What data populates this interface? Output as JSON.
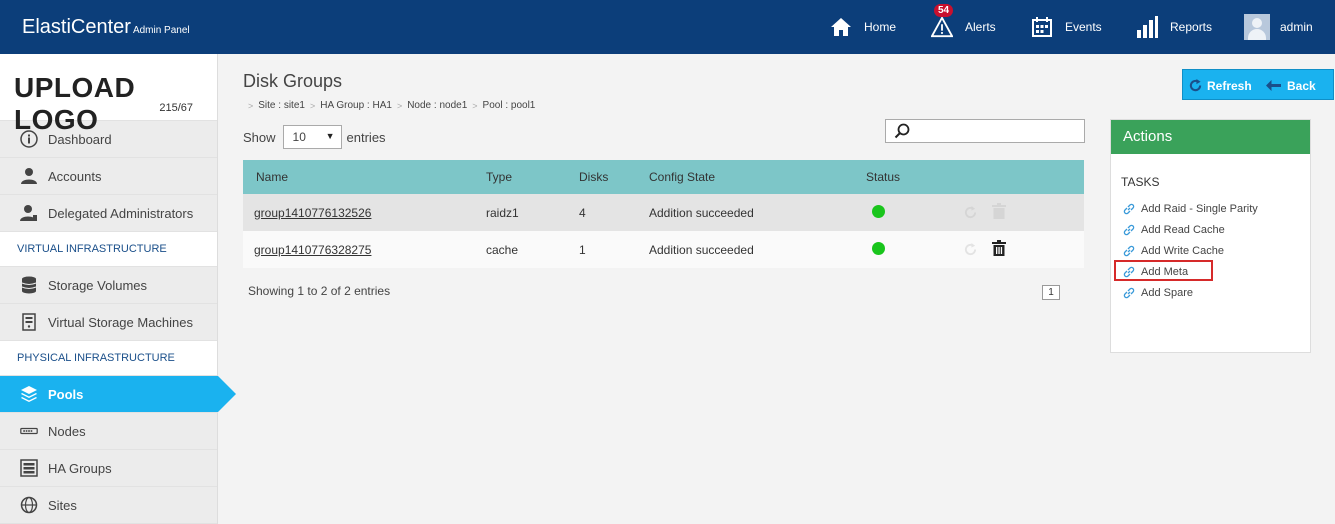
{
  "header": {
    "brand": "ElastiCenter",
    "brand_sub": "Admin Panel",
    "nav": {
      "home": "Home",
      "alerts": "Alerts",
      "alerts_badge": "54",
      "events": "Events",
      "reports": "Reports",
      "user": "admin"
    }
  },
  "sidebar": {
    "logo": "UPLOAD LOGO",
    "logo_dim": "215/67",
    "items_top": [
      {
        "label": "Dashboard",
        "icon": "info-icon"
      },
      {
        "label": "Accounts",
        "icon": "user-icon"
      },
      {
        "label": "Delegated Administrators",
        "icon": "admin-user-icon"
      }
    ],
    "section_virtual": "VIRTUAL INFRASTRUCTURE",
    "items_virtual": [
      {
        "label": "Storage Volumes",
        "icon": "database-icon"
      },
      {
        "label": "Virtual Storage Machines",
        "icon": "server-icon"
      }
    ],
    "section_physical": "PHYSICAL INFRASTRUCTURE",
    "items_physical": [
      {
        "label": "Pools",
        "icon": "layers-icon"
      },
      {
        "label": "Nodes",
        "icon": "node-icon"
      },
      {
        "label": "HA Groups",
        "icon": "rack-icon"
      },
      {
        "label": "Sites",
        "icon": "globe-icon"
      }
    ]
  },
  "main": {
    "title": "Disk Groups",
    "breadcrumb": [
      "Site : site1",
      "HA Group : HA1",
      "Node : node1",
      "Pool : pool1"
    ],
    "show_label": "Show",
    "entries_value": "10",
    "entries_label": "entries",
    "table": {
      "columns": [
        "Name",
        "Type",
        "Disks",
        "Config State",
        "Status"
      ],
      "rows": [
        {
          "name": "group1410776132526",
          "type": "raidz1",
          "disks": "4",
          "state": "Addition succeeded",
          "status": "green"
        },
        {
          "name": "group1410776328275",
          "type": "cache",
          "disks": "1",
          "state": "Addition succeeded",
          "status": "green"
        }
      ]
    },
    "info": "Showing 1 to 2 of 2 entries",
    "page": "1"
  },
  "buttons": {
    "refresh": "Refresh",
    "back": "Back"
  },
  "actions": {
    "title": "Actions",
    "tasks_label": "TASKS",
    "tasks": [
      "Add Raid - Single Parity",
      "Add Read Cache",
      "Add Write Cache",
      "Add Meta",
      "Add Spare"
    ]
  },
  "colors": {
    "header": "#0c3e7a",
    "accent": "#1ab2ef",
    "table_head": "#7dc6c8",
    "actions_head": "#3aa25a",
    "status_ok": "#19c51c",
    "highlight": "#d62a2a"
  }
}
